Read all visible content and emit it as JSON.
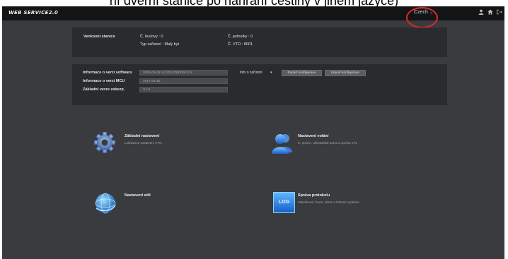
{
  "caption": "ní dveřní stanice po náhrání češtiny v jiném jazyce)",
  "header": {
    "logo": "WEB SERVICE2.0",
    "language": "Czech",
    "language_caret": "⌄",
    "user_icon": "user-icon",
    "home_icon": "home-icon",
    "logout_icon": "logout-icon"
  },
  "info": {
    "station": "Venkovní stanice",
    "building_label": "Č. budovy : 0",
    "device_type_label": "Typ zařízení : Malý byt",
    "unit_label": "Č. jednotky : 0",
    "vto_label": "Č. VTO : 8001"
  },
  "software": {
    "sw_label": "Informace o verzi softwaru",
    "sw_value": "2019-05-05 V4.200.0000000.0.R",
    "mcu_label": "Informace o verzi MCU",
    "mcu_value": "2017-05-15",
    "security_label": "Základní verze zabezp.",
    "security_value": "V1.0",
    "select_value": "Info o zařízení",
    "export_button": "Export konfigurace",
    "import_button": "Import konfigurace"
  },
  "tiles": {
    "basic_title": "Základní nastavení",
    "basic_desc": "Lokalizace nastavení VTO.",
    "call_title": "Nastavení volání",
    "call_desc": "Č. pozice, uživatelská práva a správa VTL",
    "network_title": "Nastavení sítě",
    "network_desc": "",
    "log_title": "Správa protokolu",
    "log_desc": "Odemknutí, hovor, alarm a historie systému.",
    "log_icon_text": "LOG"
  },
  "colors": {
    "app_bg": "#3a3b3f",
    "topbar_bg": "#131416",
    "panel_bg": "#2a2b2e",
    "highlight_circle": "#e3262d"
  }
}
